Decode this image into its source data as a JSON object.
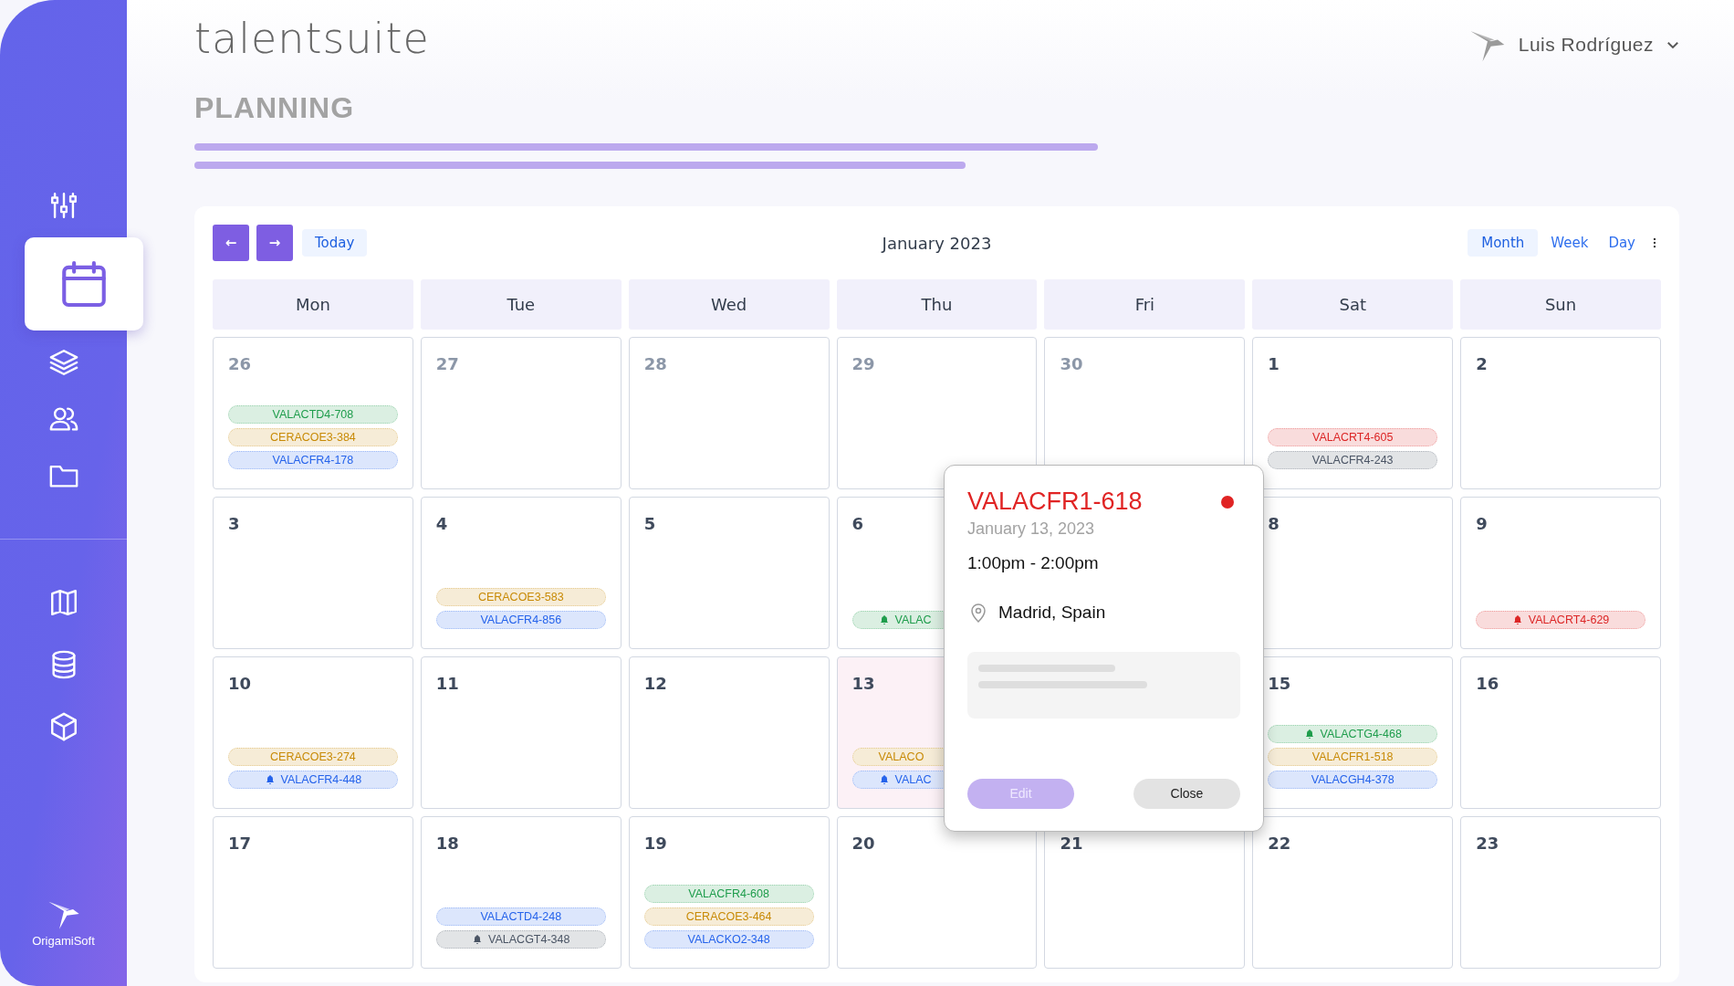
{
  "header": {
    "logo": "talentsuite",
    "user": "Luis Rodríguez"
  },
  "sidebar": {
    "items": [
      {
        "selected": false
      },
      {
        "selected": true
      },
      {
        "selected": false
      },
      {
        "selected": false
      },
      {
        "selected": false
      }
    ],
    "tools": [
      {
        "selected": false
      },
      {
        "selected": false
      },
      {
        "selected": false
      }
    ],
    "brand": "OrigamiSoft"
  },
  "page": {
    "title": "PLANNING"
  },
  "calendar": {
    "prev": "←",
    "next": "→",
    "today": "Today",
    "title": "January 2023",
    "views": [
      {
        "label": "Month",
        "selected": true
      },
      {
        "label": "Week",
        "selected": false
      },
      {
        "label": "Day",
        "selected": false
      }
    ],
    "weekdays": [
      "Mon",
      "Tue",
      "Wed",
      "Thu",
      "Fri",
      "Sat",
      "Sun"
    ],
    "weeks": [
      [
        {
          "day": "26",
          "outside_month": true,
          "selected": false,
          "events": [
            {
              "label": "VALACTD4-708",
              "color": "#1f9d4c",
              "bell": false
            },
            {
              "label": "CERACOE3-384",
              "color": "#c88a06",
              "bell": false
            },
            {
              "label": "VALACFR4-178",
              "color": "#2563eb",
              "bell": false
            }
          ]
        },
        {
          "day": "27",
          "outside_month": true,
          "selected": false
        },
        {
          "day": "28",
          "outside_month": true,
          "selected": false
        },
        {
          "day": "29",
          "outside_month": true,
          "selected": false
        },
        {
          "day": "30",
          "outside_month": true,
          "selected": false
        },
        {
          "day": "1",
          "outside_month": false,
          "selected": false,
          "events": [
            {
              "label": "VALACRT4-605",
              "color": "#dc2626",
              "bell": false
            },
            {
              "label": "VALACFR4-243",
              "color": "#4b5565",
              "bell": false
            }
          ]
        },
        {
          "day": "2",
          "outside_month": false,
          "selected": false
        }
      ],
      [
        {
          "day": "3",
          "outside_month": false,
          "selected": false
        },
        {
          "day": "4",
          "outside_month": false,
          "selected": false,
          "events": [
            {
              "label": "CERACOE3-583",
              "color": "#c88a06",
              "bell": false
            },
            {
              "label": "VALACFR4-856",
              "color": "#2563eb",
              "bell": false
            }
          ]
        },
        {
          "day": "5",
          "outside_month": false,
          "selected": false
        },
        {
          "day": "6",
          "outside_month": false,
          "selected": false,
          "covered": true,
          "events": [
            {
              "label": "VALAC",
              "color": "#1f9d4c",
              "bell": true
            }
          ]
        },
        {
          "day": "8",
          "outside_month": false,
          "selected": false
        },
        {
          "day": "9",
          "outside_month": false,
          "selected": false,
          "events": [
            {
              "label": "VALACRT4-629",
              "color": "#dc2626",
              "bell": true
            }
          ]
        }
      ],
      [
        {
          "day": "10",
          "outside_month": false,
          "selected": false,
          "events": [
            {
              "label": "CERACOE3-274",
              "color": "#c88a06",
              "bell": false
            },
            {
              "label": "VALACFR4-448",
              "color": "#2563eb",
              "bell": true
            }
          ]
        },
        {
          "day": "11",
          "outside_month": false,
          "selected": false
        },
        {
          "day": "12",
          "outside_month": false,
          "selected": false
        },
        {
          "day": "13",
          "outside_month": false,
          "selected": true,
          "covered": true,
          "events": [
            {
              "label": "VALACO",
              "color": "#c88a06",
              "bell": false
            },
            {
              "label": "VALAC",
              "color": "#2563eb",
              "bell": true
            }
          ]
        },
        {
          "day": "15",
          "outside_month": false,
          "selected": false,
          "events": [
            {
              "label": "VALACTG4-468",
              "color": "#1f9d4c",
              "bell": true
            },
            {
              "label": "VALACFR1-518",
              "color": "#c88a06",
              "bell": false
            },
            {
              "label": "VALACGH4-378",
              "color": "#2563eb",
              "bell": false
            }
          ]
        },
        {
          "day": "16",
          "outside_month": false,
          "selected": false
        }
      ],
      [
        {
          "day": "17",
          "outside_month": false,
          "selected": false
        },
        {
          "day": "18",
          "outside_month": false,
          "selected": false,
          "events": [
            {
              "label": "VALACTD4-248",
              "color": "#2563eb",
              "bell": false
            },
            {
              "label": "VALACGT4-348",
              "color": "#4b5565",
              "bell": true
            }
          ]
        },
        {
          "day": "19",
          "outside_month": false,
          "selected": false,
          "events": [
            {
              "label": "VALACFR4-608",
              "color": "#1f9d4c",
              "bell": false
            },
            {
              "label": "CERACOE3-464",
              "color": "#c88a06",
              "bell": false
            },
            {
              "label": "VALACKO2-348",
              "color": "#2563eb",
              "bell": false
            }
          ]
        },
        {
          "day": "20",
          "outside_month": false,
          "selected": false
        },
        {
          "day": "21",
          "outside_month": false,
          "selected": false
        },
        {
          "day": "22",
          "outside_month": false,
          "selected": false
        },
        {
          "day": "23",
          "outside_month": false,
          "selected": false
        }
      ]
    ]
  },
  "popup": {
    "title": "VALACFR1-618",
    "color": "#e02424",
    "date": "January 13, 2023",
    "time": "1:00pm - 2:00pm",
    "location": "Madrid, Spain",
    "edit": {
      "label": "Edit",
      "disabled": true
    },
    "close": "Close"
  }
}
